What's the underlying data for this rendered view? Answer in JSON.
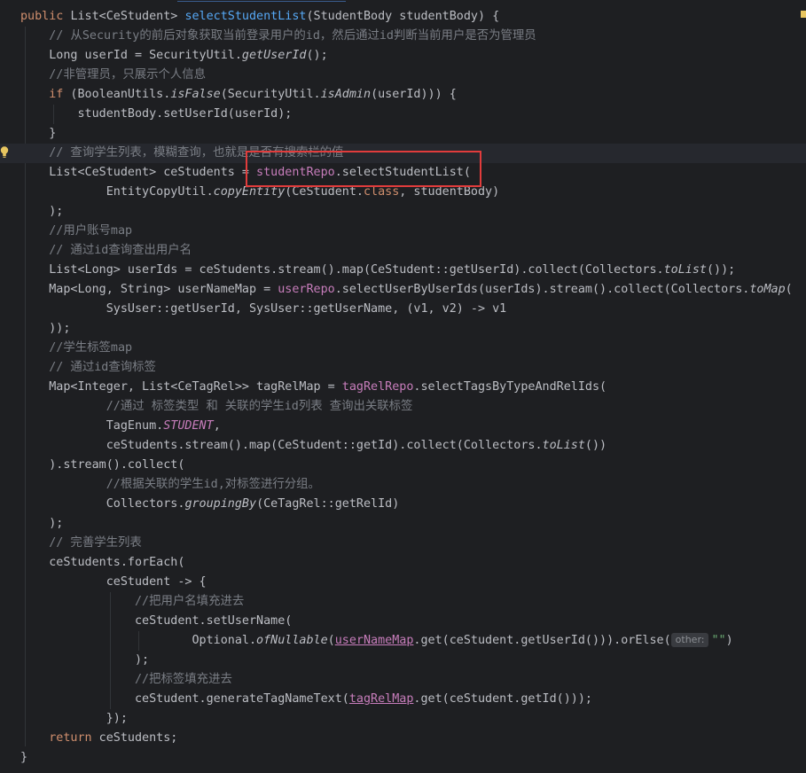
{
  "lines": [
    {
      "segs": [
        {
          "t": "public ",
          "c": "k"
        },
        {
          "t": "List<CeStudent> "
        },
        {
          "t": "selectStudentList",
          "c": "f"
        },
        {
          "t": "(StudentBody studentBody) {"
        }
      ]
    },
    {
      "segs": [
        {
          "t": "    "
        },
        {
          "t": "// 从Security的前后对象获取当前登录用户的id，然后通过id判断当前用户是否为管理员",
          "c": "c"
        }
      ]
    },
    {
      "segs": [
        {
          "t": "    Long userId = SecurityUtil."
        },
        {
          "t": "getUserId",
          "c": "i"
        },
        {
          "t": "();"
        }
      ]
    },
    {
      "segs": [
        {
          "t": "    "
        },
        {
          "t": "//非管理员，只展示个人信息",
          "c": "c"
        }
      ]
    },
    {
      "segs": [
        {
          "t": "    "
        },
        {
          "t": "if",
          "c": "k"
        },
        {
          "t": " (BooleanUtils."
        },
        {
          "t": "isFalse",
          "c": "i"
        },
        {
          "t": "(SecurityUtil."
        },
        {
          "t": "isAdmin",
          "c": "i"
        },
        {
          "t": "(userId))) {"
        }
      ]
    },
    {
      "segs": [
        {
          "t": "        studentBody.setUserId(userId);"
        }
      ]
    },
    {
      "segs": [
        {
          "t": "    }"
        }
      ]
    },
    {
      "segs": [
        {
          "t": "    "
        },
        {
          "t": "// 查询学生列表，模糊查询，也就是是否有搜索栏的值",
          "c": "c"
        }
      ],
      "hl": true
    },
    {
      "segs": [
        {
          "t": "    List<CeStudent> ceStudents = "
        },
        {
          "t": "studentRepo",
          "c": "field"
        },
        {
          "t": ".selectStudentList("
        }
      ]
    },
    {
      "segs": [
        {
          "t": "            EntityCopyUtil."
        },
        {
          "t": "copyEntity",
          "c": "i"
        },
        {
          "t": "(CeStudent."
        },
        {
          "t": "class",
          "c": "k"
        },
        {
          "t": ", studentBody)"
        }
      ]
    },
    {
      "segs": [
        {
          "t": "    );"
        }
      ]
    },
    {
      "segs": [
        {
          "t": "    "
        },
        {
          "t": "//用户账号map",
          "c": "c"
        }
      ]
    },
    {
      "segs": [
        {
          "t": "    "
        },
        {
          "t": "// 通过id查询查出用户名",
          "c": "c"
        }
      ]
    },
    {
      "segs": [
        {
          "t": "    List<Long> userIds = ceStudents.stream().map(CeStudent::getUserId).collect(Collectors."
        },
        {
          "t": "toList",
          "c": "i"
        },
        {
          "t": "());"
        }
      ]
    },
    {
      "segs": [
        {
          "t": "    Map<Long, String> userNameMap = "
        },
        {
          "t": "userRepo",
          "c": "field"
        },
        {
          "t": ".selectUserByUserIds(userIds).stream().collect(Collectors."
        },
        {
          "t": "toMap",
          "c": "i"
        },
        {
          "t": "("
        }
      ]
    },
    {
      "segs": [
        {
          "t": "            SysUser::getUserId, SysUser::getUserName, (v1, v2) -> v1"
        }
      ]
    },
    {
      "segs": [
        {
          "t": "    ));"
        }
      ]
    },
    {
      "segs": [
        {
          "t": "    "
        },
        {
          "t": "//学生标签map",
          "c": "c"
        }
      ]
    },
    {
      "segs": [
        {
          "t": "    "
        },
        {
          "t": "// 通过id查询标签",
          "c": "c"
        }
      ]
    },
    {
      "segs": [
        {
          "t": "    Map<Integer, List<CeTagRel>> tagRelMap = "
        },
        {
          "t": "tagRelRepo",
          "c": "field"
        },
        {
          "t": ".selectTagsByTypeAndRelIds("
        }
      ]
    },
    {
      "segs": [
        {
          "t": "            "
        },
        {
          "t": "//通过 标签类型 和 关联的学生id列表 查询出关联标签",
          "c": "c"
        }
      ]
    },
    {
      "segs": [
        {
          "t": "            TagEnum."
        },
        {
          "t": "STUDENT",
          "c": "cst"
        },
        {
          "t": ","
        }
      ]
    },
    {
      "segs": [
        {
          "t": "            ceStudents.stream().map(CeStudent::getId).collect(Collectors."
        },
        {
          "t": "toList",
          "c": "i"
        },
        {
          "t": "())"
        }
      ]
    },
    {
      "segs": [
        {
          "t": "    ).stream().collect("
        }
      ]
    },
    {
      "segs": [
        {
          "t": "            "
        },
        {
          "t": "//根据关联的学生id,对标签进行分组。",
          "c": "c"
        }
      ]
    },
    {
      "segs": [
        {
          "t": "            Collectors."
        },
        {
          "t": "groupingBy",
          "c": "i"
        },
        {
          "t": "(CeTagRel::getRelId)"
        }
      ]
    },
    {
      "segs": [
        {
          "t": "    );"
        }
      ]
    },
    {
      "segs": [
        {
          "t": "    "
        },
        {
          "t": "// 完善学生列表",
          "c": "c"
        }
      ]
    },
    {
      "segs": [
        {
          "t": "    ceStudents.forEach("
        }
      ]
    },
    {
      "segs": [
        {
          "t": "            ceStudent -> {"
        }
      ]
    },
    {
      "segs": [
        {
          "t": "                "
        },
        {
          "t": "//把用户名填充进去",
          "c": "c"
        }
      ]
    },
    {
      "segs": [
        {
          "t": "                ceStudent.setUserName("
        }
      ]
    },
    {
      "segs": [
        {
          "t": "                        Optional."
        },
        {
          "t": "ofNullable",
          "c": "i"
        },
        {
          "t": "("
        },
        {
          "t": "userNameMap",
          "c": "field und"
        },
        {
          "t": ".get(ceStudent.getUserId())).orElse("
        },
        {
          "t": "other:",
          "c": "hint"
        },
        {
          "t": "\"\"",
          "c": "s"
        },
        {
          "t": ")"
        }
      ]
    },
    {
      "segs": [
        {
          "t": "                );"
        }
      ]
    },
    {
      "segs": [
        {
          "t": "                "
        },
        {
          "t": "//把标签填充进去",
          "c": "c"
        }
      ]
    },
    {
      "segs": [
        {
          "t": "                ceStudent.generateTagNameText("
        },
        {
          "t": "tagRelMap",
          "c": "field und"
        },
        {
          "t": ".get(ceStudent.getId()));"
        }
      ]
    },
    {
      "segs": [
        {
          "t": "            });"
        }
      ]
    },
    {
      "segs": [
        {
          "t": "    "
        },
        {
          "t": "return",
          "c": "k"
        },
        {
          "t": " ceStudents;"
        }
      ]
    },
    {
      "segs": [
        {
          "t": "}"
        }
      ]
    }
  ],
  "icons": {
    "gutter": "lightbulb-icon"
  },
  "colors": {
    "background": "#1e1f22",
    "highlight_box": "#e13c3c",
    "keyword": "#cf8e6d",
    "method_decl": "#56a8f5",
    "comment": "#7a7e85",
    "field": "#c77dbb",
    "string": "#6aab73"
  }
}
